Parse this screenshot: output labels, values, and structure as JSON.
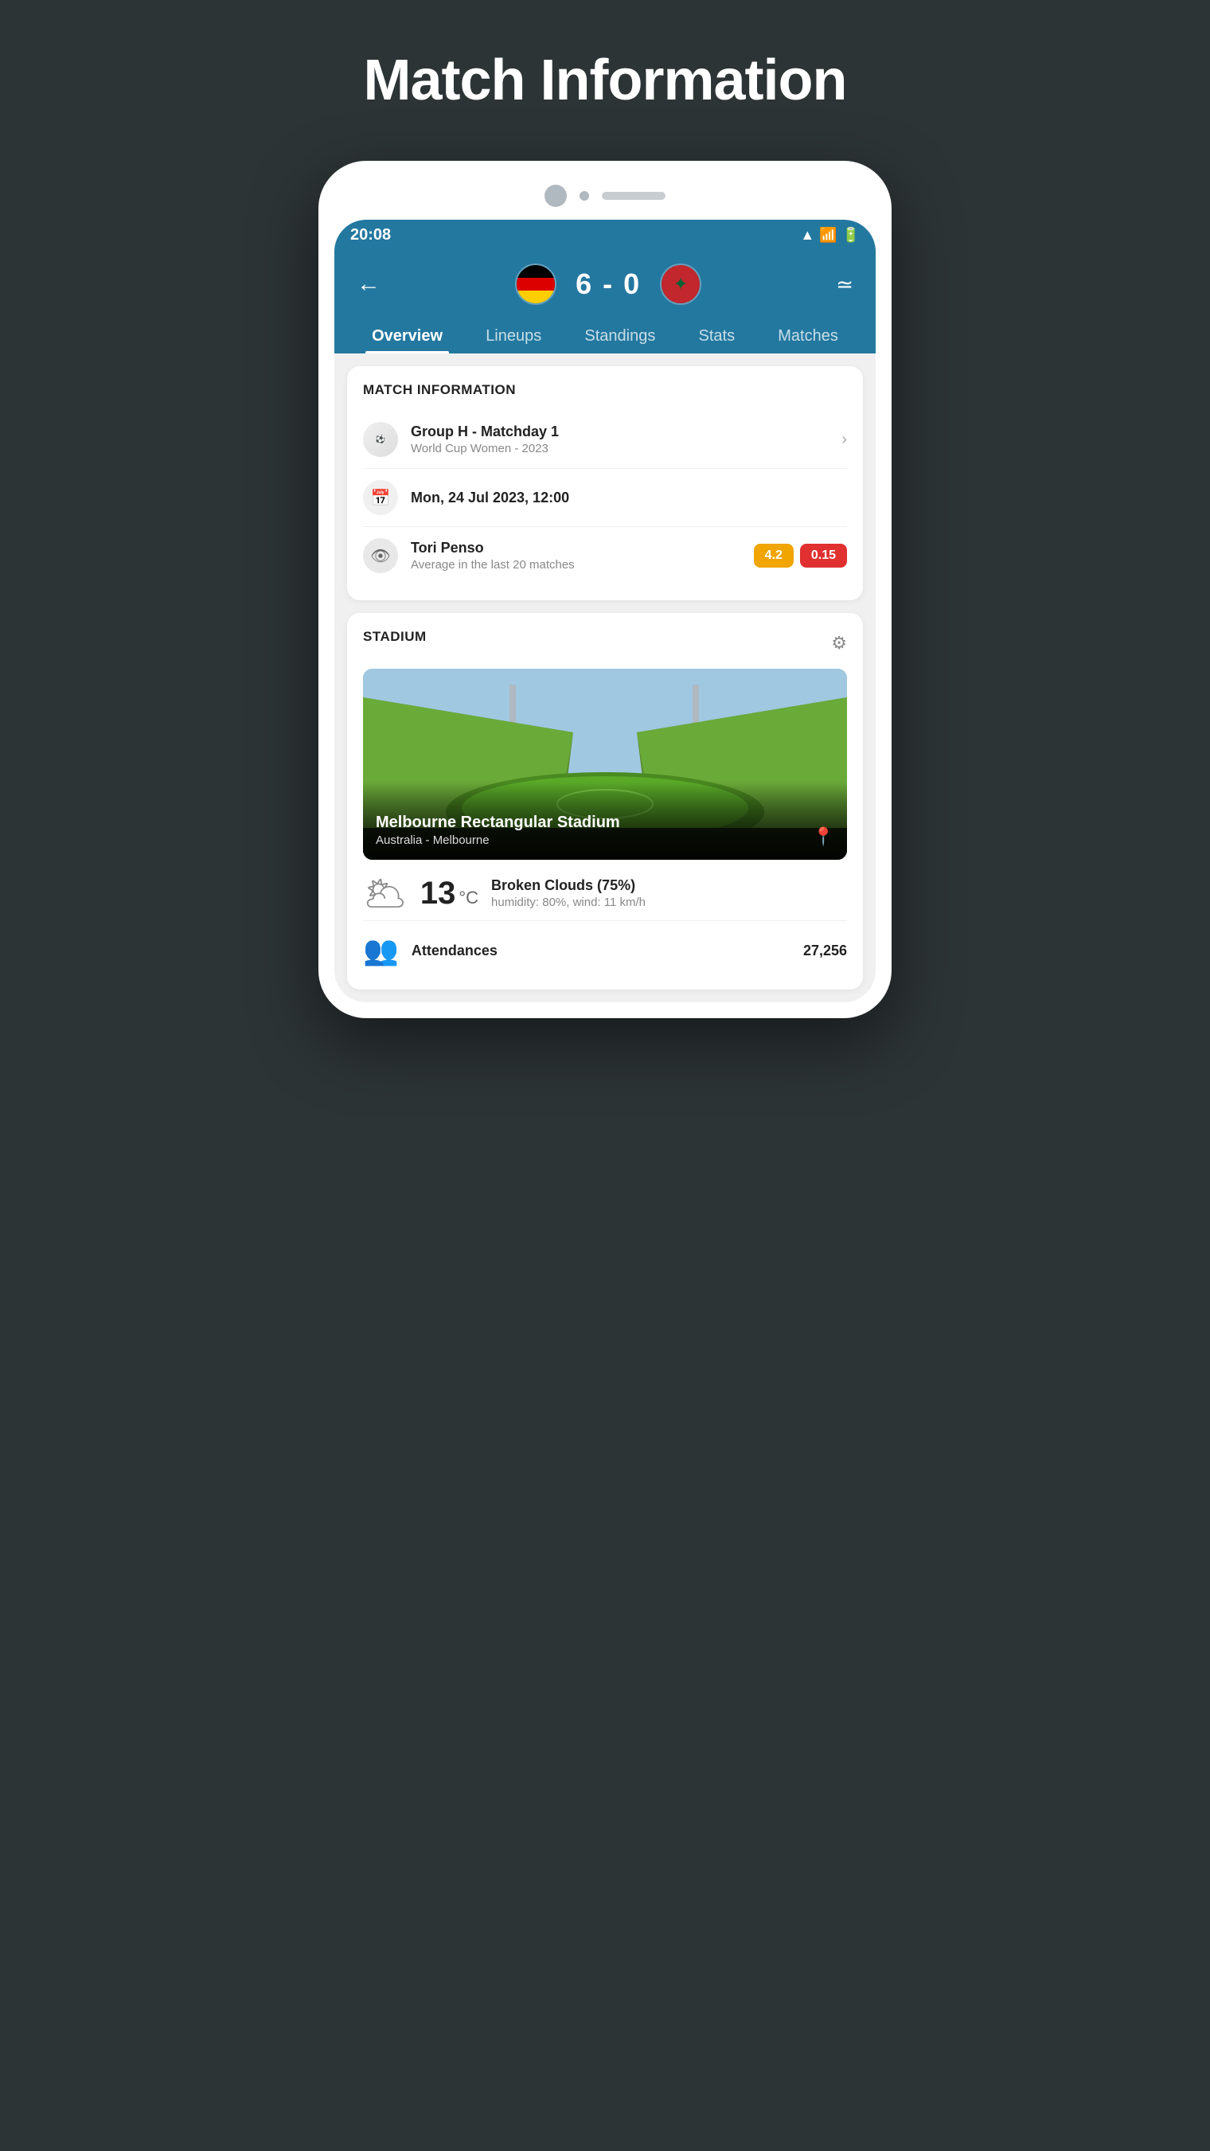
{
  "page": {
    "title": "Match Information"
  },
  "status_bar": {
    "time": "20:08"
  },
  "header": {
    "score": "6 - 0",
    "team_home": "Germany",
    "team_away": "Morocco"
  },
  "tabs": [
    {
      "id": "overview",
      "label": "Overview",
      "active": true
    },
    {
      "id": "lineups",
      "label": "Lineups",
      "active": false
    },
    {
      "id": "standings",
      "label": "Standings",
      "active": false
    },
    {
      "id": "stats",
      "label": "Stats",
      "active": false
    },
    {
      "id": "matches",
      "label": "Matches",
      "active": false
    }
  ],
  "match_info": {
    "section_title": "MATCH INFORMATION",
    "competition": {
      "main": "Group H - Matchday 1",
      "sub": "World Cup Women - 2023"
    },
    "date": {
      "main": "Mon, 24 Jul 2023, 12:00"
    },
    "referee": {
      "name": "Tori Penso",
      "sub": "Average in the last 20 matches",
      "badge_yellow": "4.2",
      "badge_red": "0.15"
    }
  },
  "stadium": {
    "section_title": "STADIUM",
    "name": "Melbourne Rectangular Stadium",
    "location": "Australia - Melbourne"
  },
  "weather": {
    "temperature": "13",
    "unit": "°C",
    "condition": "Broken Clouds (75%)",
    "details": "humidity: 80%, wind: 11 km/h"
  },
  "attendance": {
    "label": "Attendances",
    "value": "27,256"
  }
}
